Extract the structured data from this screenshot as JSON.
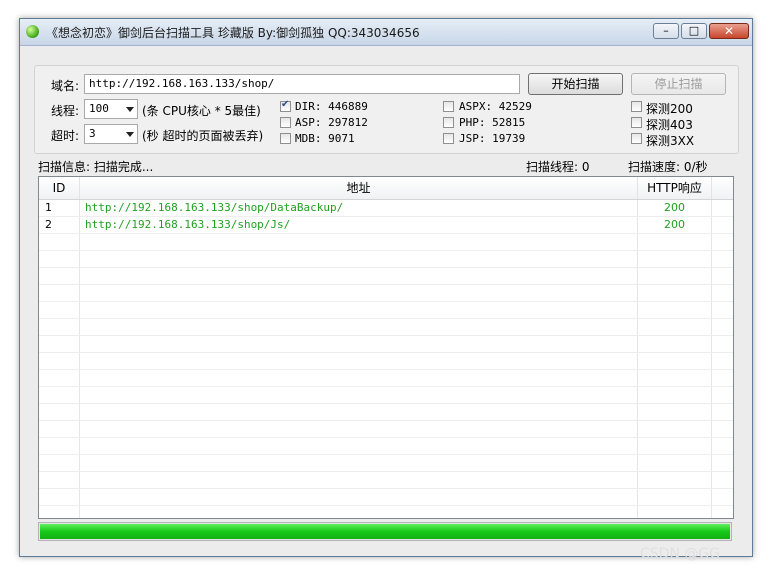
{
  "window": {
    "title": "《想念初恋》御剑后台扫描工具 珍藏版 By:御剑孤独 QQ:343034656",
    "min_glyph": "–",
    "max_glyph": "□",
    "close_glyph": "✕"
  },
  "form": {
    "domain_label": "域名:",
    "domain_value": "http://192.168.163.133/shop/",
    "start_button": "开始扫描",
    "stop_button": "停止扫描",
    "threads_label": "线程:",
    "threads_value": "100",
    "threads_hint": "(条 CPU核心 * 5最佳)",
    "timeout_label": "超时:",
    "timeout_value": "3",
    "timeout_hint": "(秒 超时的页面被丢弃)"
  },
  "dicts": [
    {
      "label": "DIR: 446889",
      "checked": true
    },
    {
      "label": "ASP: 297812",
      "checked": false
    },
    {
      "label": "MDB: 9071",
      "checked": false
    },
    {
      "label": "ASPX: 42529",
      "checked": false
    },
    {
      "label": "PHP: 52815",
      "checked": false
    },
    {
      "label": "JSP: 19739",
      "checked": false
    }
  ],
  "probes": [
    {
      "label": "探测200",
      "checked": false
    },
    {
      "label": "探测403",
      "checked": false
    },
    {
      "label": "探测3XX",
      "checked": false
    }
  ],
  "status": {
    "info": "扫描信息: 扫描完成...",
    "threads": "扫描线程: 0",
    "speed": "扫描速度: 0/秒"
  },
  "table": {
    "headers": {
      "id": "ID",
      "url": "地址",
      "http": "HTTP响应"
    },
    "rows": [
      {
        "id": "1",
        "url": "http://192.168.163.133/shop/DataBackup/",
        "code": "200"
      },
      {
        "id": "2",
        "url": "http://192.168.163.133/shop/Js/",
        "code": "200"
      }
    ]
  },
  "progress": {
    "fraction": 1.0
  },
  "colors": {
    "result_text": "#20a020",
    "progress": "#18c818"
  },
  "watermark": "CSDN @GG"
}
